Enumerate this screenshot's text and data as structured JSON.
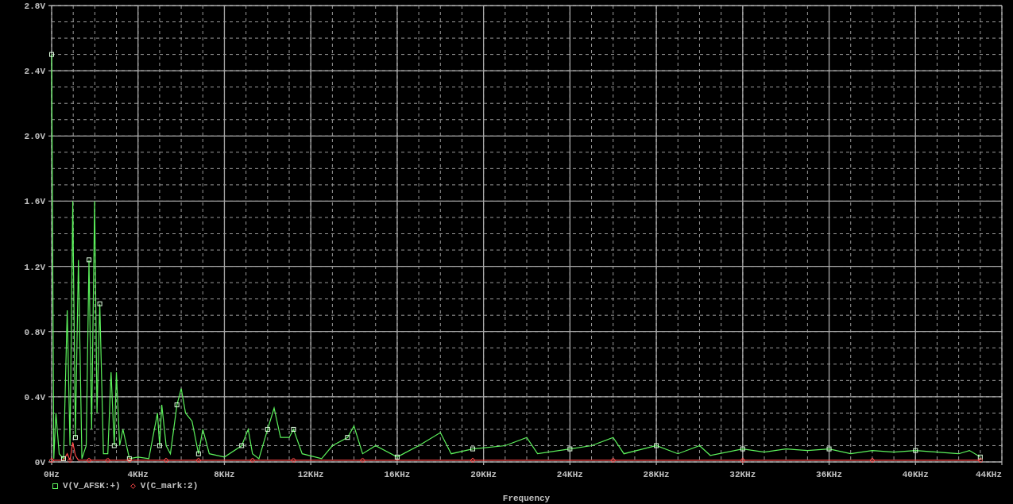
{
  "plot": {
    "chart_data": {
      "type": "line",
      "xlabel": "Frequency",
      "grid": true,
      "legend": true,
      "xlim": [
        0,
        44
      ],
      "ylim": [
        0,
        2.8
      ],
      "xticks": [
        {
          "value": 0,
          "label": "0Hz"
        },
        {
          "value": 4,
          "label": "4KHz"
        },
        {
          "value": 8,
          "label": "8KHz"
        },
        {
          "value": 12,
          "label": "12KHz"
        },
        {
          "value": 16,
          "label": "16KHz"
        },
        {
          "value": 20,
          "label": "20KHz"
        },
        {
          "value": 24,
          "label": "24KHz"
        },
        {
          "value": 28,
          "label": "28KHz"
        },
        {
          "value": 32,
          "label": "32KHz"
        },
        {
          "value": 36,
          "label": "36KHz"
        },
        {
          "value": 40,
          "label": "40KHz"
        },
        {
          "value": 44,
          "label": "44KHz"
        }
      ],
      "yticks": [
        {
          "value": 0,
          "label": "0V"
        },
        {
          "value": 0.4,
          "label": "0.4V"
        },
        {
          "value": 0.8,
          "label": "0.8V"
        },
        {
          "value": 1.2,
          "label": "1.2V"
        },
        {
          "value": 1.6,
          "label": "1.6V"
        },
        {
          "value": 2.0,
          "label": "2.0V"
        },
        {
          "value": 2.4,
          "label": "2.4V"
        },
        {
          "value": 2.8,
          "label": "2.8V"
        }
      ],
      "x": [
        0,
        0.1,
        0.2,
        0.35,
        0.55,
        0.72,
        0.85,
        0.98,
        1.1,
        1.24,
        1.4,
        1.6,
        1.73,
        1.85,
        1.99,
        2.1,
        2.23,
        2.4,
        2.6,
        2.75,
        2.9,
        3.0,
        3.15,
        3.3,
        3.6,
        4.0,
        4.5,
        4.9,
        5.0,
        5.1,
        5.3,
        5.5,
        5.8,
        6.0,
        6.2,
        6.5,
        6.8,
        7.0,
        7.3,
        8.0,
        8.8,
        9.1,
        9.3,
        9.6,
        10.0,
        10.3,
        10.6,
        11.0,
        11.2,
        11.6,
        12.5,
        13.0,
        13.7,
        14.0,
        14.4,
        15,
        16,
        17,
        18,
        18.5,
        19.5,
        21,
        22,
        22.5,
        24,
        25,
        26,
        26.5,
        28,
        29,
        30,
        30.5,
        32,
        33,
        34,
        35,
        36,
        37,
        38,
        39,
        40,
        41,
        42,
        42.5,
        43
      ],
      "series": [
        {
          "name": "V(V_AFSK:+)",
          "color": "#5cf25c",
          "values": [
            2.5,
            0.02,
            0.3,
            0.05,
            0.02,
            0.93,
            0.1,
            1.6,
            0.15,
            1.24,
            0.02,
            0.1,
            1.24,
            0.2,
            1.6,
            0.3,
            0.97,
            0.05,
            0.05,
            0.55,
            0.1,
            0.55,
            0.1,
            0.2,
            0.02,
            0.03,
            0.02,
            0.3,
            0.1,
            0.35,
            0.1,
            0.05,
            0.35,
            0.45,
            0.3,
            0.25,
            0.05,
            0.2,
            0.05,
            0.03,
            0.1,
            0.2,
            0.05,
            0.02,
            0.2,
            0.33,
            0.15,
            0.15,
            0.2,
            0.05,
            0.02,
            0.1,
            0.15,
            0.22,
            0.05,
            0.1,
            0.03,
            0.1,
            0.18,
            0.05,
            0.08,
            0.1,
            0.15,
            0.05,
            0.08,
            0.1,
            0.15,
            0.05,
            0.1,
            0.05,
            0.1,
            0.04,
            0.08,
            0.06,
            0.08,
            0.07,
            0.08,
            0.05,
            0.07,
            0.06,
            0.07,
            0.06,
            0.05,
            0.07,
            0.03
          ]
        },
        {
          "name": "V(C_mark:2)",
          "color": "#ff4848",
          "values": [
            0.01,
            0.01,
            0.01,
            0.01,
            0.01,
            0.05,
            0.01,
            0.12,
            0.04,
            0.01,
            0.01,
            0.01,
            0.01,
            0.01,
            0.01,
            0.01,
            0.01,
            0.01,
            0.01,
            0.01,
            0.01,
            0.01,
            0.01,
            0.01,
            0.01,
            0.01,
            0.01,
            0.01,
            0.01,
            0.01,
            0.01,
            0.01,
            0.01,
            0.01,
            0.01,
            0.01,
            0.01,
            0.01,
            0.01,
            0.01,
            0.01,
            0.01,
            0.01,
            0.01,
            0.01,
            0.01,
            0.01,
            0.01,
            0.01,
            0.01,
            0.01,
            0.01,
            0.01,
            0.01,
            0.01,
            0.01,
            0.01,
            0.01,
            0.01,
            0.01,
            0.01,
            0.01,
            0.01,
            0.01,
            0.01,
            0.01,
            0.01,
            0.01,
            0.01,
            0.01,
            0.01,
            0.01,
            0.01,
            0.01,
            0.01,
            0.01,
            0.01,
            0.01,
            0.01,
            0.01,
            0.01,
            0.01,
            0.01,
            0.01,
            0.01
          ]
        }
      ]
    }
  }
}
